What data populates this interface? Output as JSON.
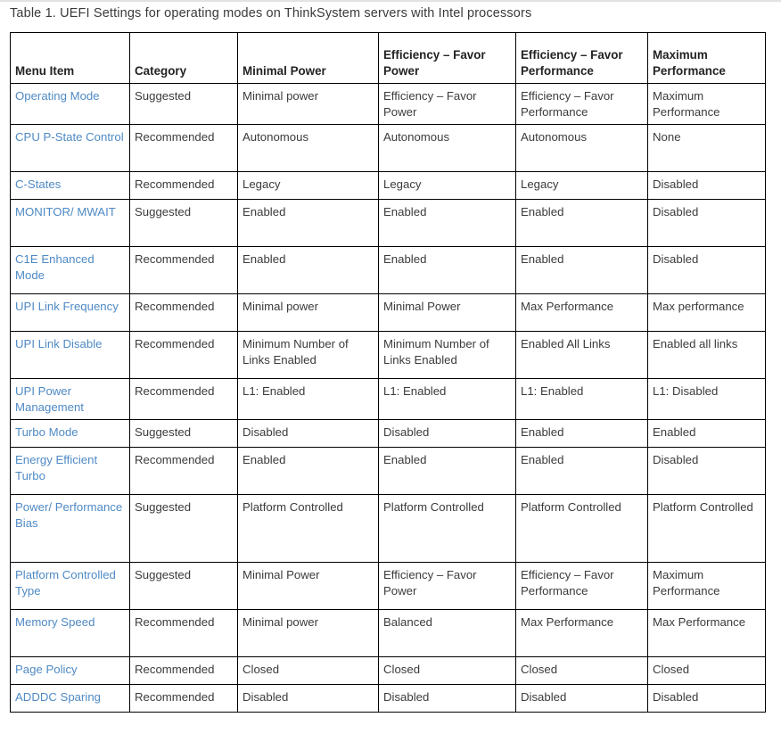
{
  "caption": "Table 1. UEFI Settings for operating modes on ThinkSystem servers with Intel processors",
  "colors": {
    "link": "#4f8ac4",
    "text": "#3b3b3b",
    "border": "#000000",
    "background": "#ffffff",
    "top_rule": "#e2e2e2"
  },
  "table": {
    "headers": [
      "Menu Item",
      "Category",
      "Minimal Power",
      "Efficiency – Favor Power",
      "Efficiency – Favor Performance",
      "Maximum Performance"
    ],
    "rows": [
      {
        "menu_item": "Operating Mode",
        "category": "Suggested",
        "minimal_power": "Minimal power",
        "efficiency_favor_power": "Efficiency – Favor Power",
        "efficiency_favor_performance": "Efficiency – Favor Performance",
        "maximum_performance": "Maximum Performance"
      },
      {
        "menu_item": "CPU P-State Control",
        "category": "Recommended",
        "minimal_power": "Autonomous",
        "efficiency_favor_power": "Autonomous",
        "efficiency_favor_performance": "Autonomous",
        "maximum_performance": "None"
      },
      {
        "menu_item": "C-States",
        "category": "Recommended",
        "minimal_power": "Legacy",
        "efficiency_favor_power": "Legacy",
        "efficiency_favor_performance": "Legacy",
        "maximum_performance": "Disabled"
      },
      {
        "menu_item": "MONITOR/ MWAIT",
        "category": "Suggested",
        "minimal_power": "Enabled",
        "efficiency_favor_power": "Enabled",
        "efficiency_favor_performance": "Enabled",
        "maximum_performance": "Disabled"
      },
      {
        "menu_item": "C1E Enhanced Mode",
        "category": "Recommended",
        "minimal_power": "Enabled",
        "efficiency_favor_power": "Enabled",
        "efficiency_favor_performance": "Enabled",
        "maximum_performance": "Disabled"
      },
      {
        "menu_item": "UPI Link Frequency",
        "category": "Recommended",
        "minimal_power": "Minimal power",
        "efficiency_favor_power": "Minimal Power",
        "efficiency_favor_performance": "Max Performance",
        "maximum_performance": "Max performance"
      },
      {
        "menu_item": "UPI Link Disable",
        "category": "Recommended",
        "minimal_power": "Minimum Number of Links Enabled",
        "efficiency_favor_power": "Minimum Number of Links Enabled",
        "efficiency_favor_performance": "Enabled All Links",
        "maximum_performance": "Enabled all links"
      },
      {
        "menu_item": "UPI Power Management",
        "category": "Recommended",
        "minimal_power": "L1: Enabled",
        "efficiency_favor_power": "L1: Enabled",
        "efficiency_favor_performance": "L1: Enabled",
        "maximum_performance": "L1: Disabled"
      },
      {
        "menu_item": "Turbo Mode",
        "category": "Suggested",
        "minimal_power": "Disabled",
        "efficiency_favor_power": "Disabled",
        "efficiency_favor_performance": "Enabled",
        "maximum_performance": "Enabled"
      },
      {
        "menu_item": "Energy Efficient Turbo",
        "category": "Recommended",
        "minimal_power": "Enabled",
        "efficiency_favor_power": "Enabled",
        "efficiency_favor_performance": "Enabled",
        "maximum_performance": "Disabled"
      },
      {
        "menu_item": "Power/ Performance Bias",
        "category": "Suggested",
        "minimal_power": "Platform Controlled",
        "efficiency_favor_power": "Platform Controlled",
        "efficiency_favor_performance": "Platform Controlled",
        "maximum_performance": "Platform Controlled"
      },
      {
        "menu_item": "Platform Controlled Type",
        "category": "Suggested",
        "minimal_power": "Minimal Power",
        "efficiency_favor_power": "Efficiency – Favor Power",
        "efficiency_favor_performance": "Efficiency – Favor Performance",
        "maximum_performance": "Maximum Performance"
      },
      {
        "menu_item": "Memory Speed",
        "category": "Recommended",
        "minimal_power": "Minimal power",
        "efficiency_favor_power": "Balanced",
        "efficiency_favor_performance": "Max Performance",
        "maximum_performance": "Max Performance"
      },
      {
        "menu_item": "Page Policy",
        "category": "Recommended",
        "minimal_power": "Closed",
        "efficiency_favor_power": "Closed",
        "efficiency_favor_performance": "Closed",
        "maximum_performance": "Closed"
      },
      {
        "menu_item": "ADDDC Sparing",
        "category": "Recommended",
        "minimal_power": "Disabled",
        "efficiency_favor_power": "Disabled",
        "efficiency_favor_performance": "Disabled",
        "maximum_performance": "Disabled"
      }
    ]
  }
}
